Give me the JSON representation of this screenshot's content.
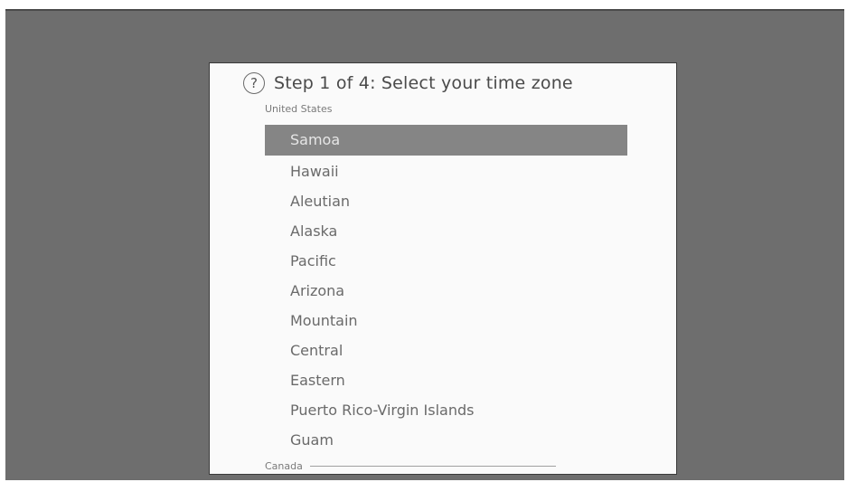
{
  "dialog": {
    "title": "Step 1 of 4: Select your time zone",
    "help_icon_symbol": "?",
    "section_label": "United States",
    "timezones": [
      {
        "label": "Samoa",
        "selected": true
      },
      {
        "label": "Hawaii",
        "selected": false
      },
      {
        "label": "Aleutian",
        "selected": false
      },
      {
        "label": "Alaska",
        "selected": false
      },
      {
        "label": "Pacific",
        "selected": false
      },
      {
        "label": "Arizona",
        "selected": false
      },
      {
        "label": "Mountain",
        "selected": false
      },
      {
        "label": "Central",
        "selected": false
      },
      {
        "label": "Eastern",
        "selected": false
      },
      {
        "label": "Puerto Rico-Virgin Islands",
        "selected": false
      },
      {
        "label": "Guam",
        "selected": false
      }
    ],
    "next_section_label": "Canada"
  },
  "colors": {
    "background": "#6e6e6e",
    "dialog_background": "#fafafa",
    "selection_highlight": "#858585",
    "text": "#6a6a6a"
  },
  "icons": {
    "help": "help-icon"
  }
}
